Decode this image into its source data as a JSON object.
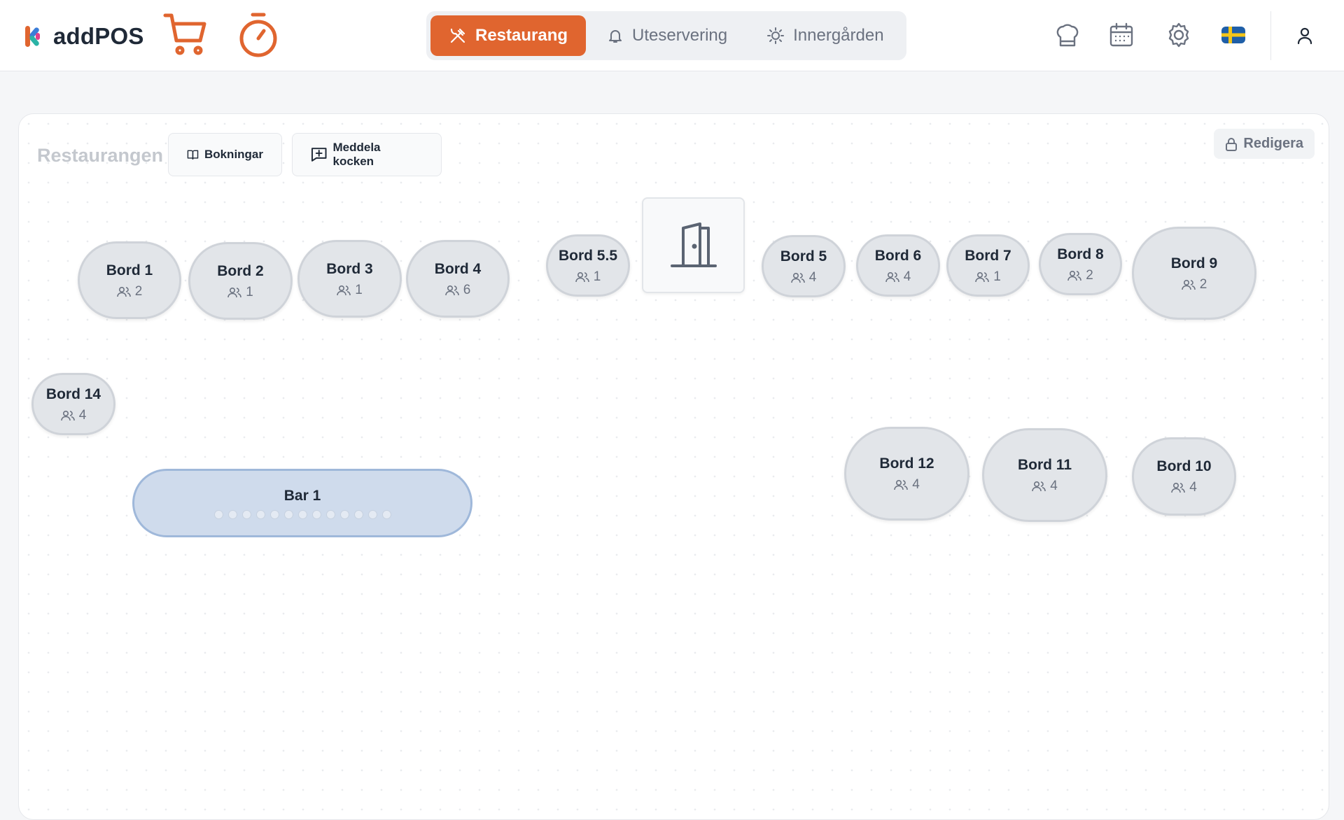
{
  "app": {
    "name": "addPOS"
  },
  "tabs": [
    {
      "label": "Restaurang",
      "icon": "utensils-icon",
      "active": true
    },
    {
      "label": "Uteservering",
      "icon": "bell-icon",
      "active": false
    },
    {
      "label": "Innergården",
      "icon": "sun-icon",
      "active": false
    }
  ],
  "toolbar": {
    "kitchen_icon": "chef-hat-icon",
    "calendar_icon": "calendar-icon",
    "settings_icon": "gear-icon",
    "language_icon": "swedish-flag-icon",
    "user_icon": "user-icon"
  },
  "floor": {
    "title": "Restaurangen",
    "bookings_label": "Bokningar",
    "notify_chef_label": "Meddela kocken",
    "edit_label": "Redigera"
  },
  "tables": [
    {
      "name": "Bord 1",
      "seats": "2"
    },
    {
      "name": "Bord 2",
      "seats": "1"
    },
    {
      "name": "Bord 3",
      "seats": "1"
    },
    {
      "name": "Bord 4",
      "seats": "6"
    },
    {
      "name": "Bord 5.5",
      "seats": "1"
    },
    {
      "name": "Bord 5",
      "seats": "4"
    },
    {
      "name": "Bord 6",
      "seats": "4"
    },
    {
      "name": "Bord 7",
      "seats": "1"
    },
    {
      "name": "Bord 8",
      "seats": "2"
    },
    {
      "name": "Bord 9",
      "seats": "2"
    },
    {
      "name": "Bord 14",
      "seats": "4"
    },
    {
      "name": "Bord 12",
      "seats": "4"
    },
    {
      "name": "Bord 11",
      "seats": "4"
    },
    {
      "name": "Bord 10",
      "seats": "4"
    }
  ],
  "bar": {
    "name": "Bar 1",
    "seat_count": 13
  },
  "colors": {
    "accent": "#e0652f",
    "table": "#e2e5e9",
    "bar": "#cfdbec"
  }
}
